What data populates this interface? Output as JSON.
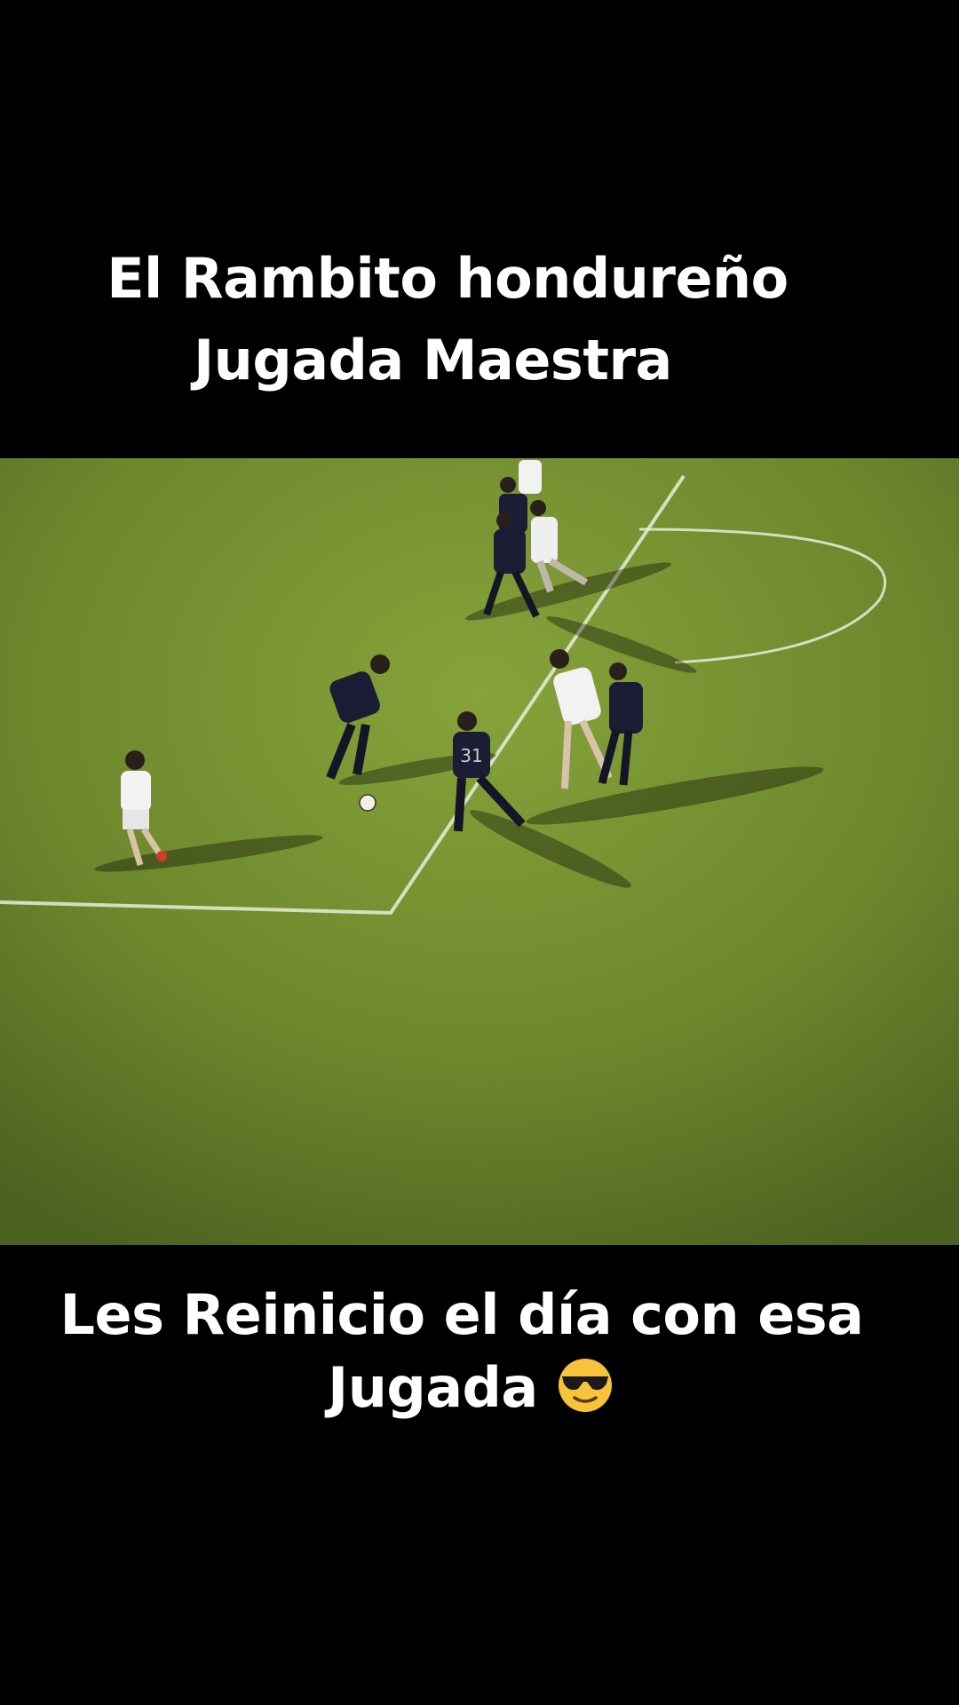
{
  "captions": {
    "top_line1": "El Rambito hondureño",
    "top_line2": "Jugada Maestra",
    "bottom_line1": "Les Reinicio el día con esa",
    "bottom_line2": "Jugada"
  },
  "video": {
    "jersey_number": "31",
    "pitch_color": "#6f8a2c"
  },
  "icons": {
    "emoji": "sunglasses-face"
  }
}
